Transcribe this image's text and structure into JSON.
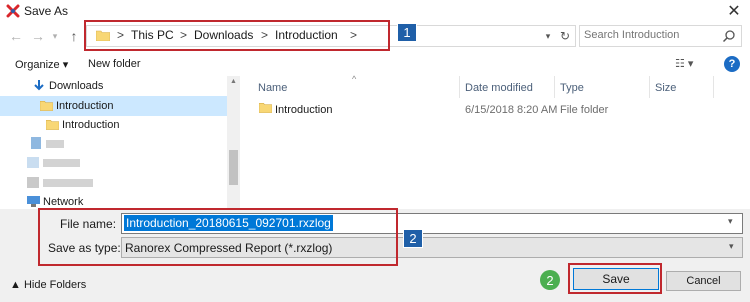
{
  "window": {
    "title": "Save As",
    "close_glyph": "✕"
  },
  "nav": {
    "back_glyph": "←",
    "forward_glyph": "→",
    "recent_glyph": "▾",
    "up_glyph": "↑"
  },
  "address": {
    "crumbs": [
      "This PC",
      "Downloads",
      "Introduction"
    ],
    "separator": ">",
    "dropdown_glyph": "▾",
    "refresh_glyph": "↻"
  },
  "search": {
    "placeholder": "Search Introduction"
  },
  "toolbar": {
    "organize_label": "Organize ▾",
    "new_folder_label": "New folder",
    "view_label": "☷ ▾",
    "help_glyph": "?"
  },
  "navpane": {
    "items": [
      {
        "label": "Downloads",
        "icon": "download-arrow-icon"
      },
      {
        "label": "Introduction",
        "icon": "folder-icon",
        "selected": true
      },
      {
        "label": "Introduction",
        "icon": "folder-icon"
      },
      {
        "label": "Network",
        "icon": "network-icon"
      }
    ],
    "scroll_up_glyph": "▲"
  },
  "columns": {
    "name": "Name",
    "date": "Date modified",
    "type": "Type",
    "size": "Size",
    "sort_glyph": "^"
  },
  "files": [
    {
      "name": "Introduction",
      "date": "6/15/2018 8:20 AM",
      "type": "File folder",
      "size": ""
    }
  ],
  "form": {
    "file_name_label": "File name:",
    "file_name_value": "Introduction_20180615_092701.rxzlog",
    "save_type_label": "Save as type:",
    "save_type_value": "Ranorex Compressed Report (*.rxzlog)",
    "dropdown_glyph": "▾"
  },
  "footer": {
    "hide_folders_label": "▲  Hide Folders",
    "save_label": "Save",
    "cancel_label": "Cancel"
  },
  "callouts": [
    "1",
    "2",
    "2"
  ],
  "colors": {
    "accent": "#0078d7",
    "callout_red": "#c0282e",
    "badge_blue": "#1f5fa8",
    "badge_green": "#4caf50",
    "folder_yellow": "#f8d775"
  }
}
